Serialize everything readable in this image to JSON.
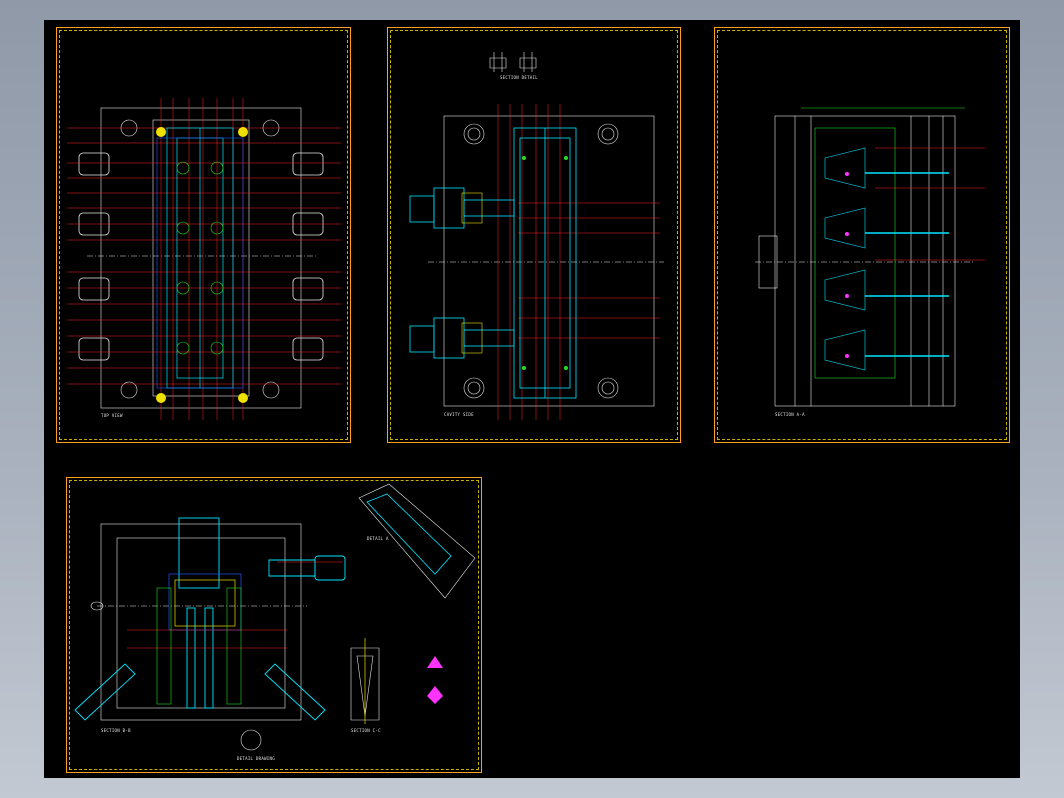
{
  "app": {
    "window_title": "",
    "background_top": "#8f99a8",
    "canvas_color": "#000000"
  },
  "sheets": [
    {
      "id": "top-view",
      "caption": "TOP VIEW",
      "border_color": "#ff9f1a"
    },
    {
      "id": "cavity-side",
      "caption": "CAVITY SIDE",
      "border_color": "#ff9f1a",
      "header": "SECTION DETAIL",
      "top_label": ""
    },
    {
      "id": "section-view",
      "caption": "SECTION A-A",
      "border_color": "#ff9f1a"
    },
    {
      "id": "section-b",
      "caption": "SECTION B-B",
      "border_color": "#ff9f1a",
      "detail_a": "DETAIL A",
      "detail_c": "SECTION C-C",
      "detail_bottom": "DETAIL DRAWING"
    }
  ],
  "colors": {
    "red": "#ff2020",
    "cyan": "#00e6ff",
    "green": "#22dd22",
    "yellow": "#f0e000",
    "white": "#e8e8e8",
    "blue": "#2255ff",
    "magenta": "#ff33ff"
  }
}
